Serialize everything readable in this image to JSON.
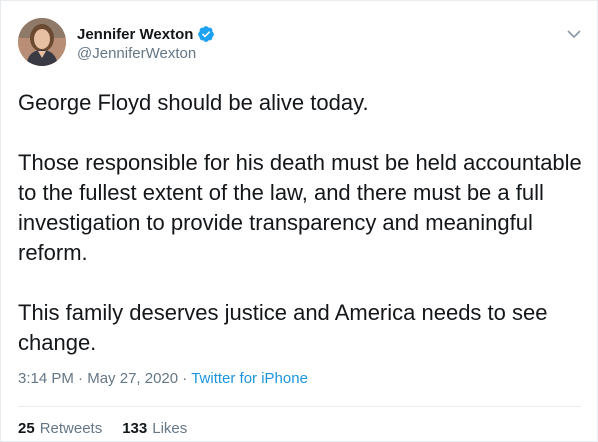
{
  "author": {
    "name": "Jennifer Wexton",
    "handle": "@JenniferWexton"
  },
  "tweet": {
    "paragraphs": [
      "George Floyd should be alive today.",
      "Those responsible for his death must be held accountable to the fullest extent of the law, and there must be a full investigation to provide transparency and meaningful reform.",
      "This family deserves justice and America needs to see change."
    ],
    "time": "3:14 PM",
    "separator1": " · ",
    "date": "May 27, 2020",
    "separator2": " · ",
    "source": "Twitter for iPhone"
  },
  "stats": {
    "retweets_count": "25",
    "retweets_label": "Retweets",
    "likes_count": "133",
    "likes_label": "Likes"
  },
  "icons": {
    "verified": "verified-badge-icon",
    "caret": "chevron-down-icon"
  },
  "colors": {
    "accent": "#1b95e0",
    "verified": "#1da1f2",
    "muted": "#657786",
    "text": "#14171a"
  }
}
